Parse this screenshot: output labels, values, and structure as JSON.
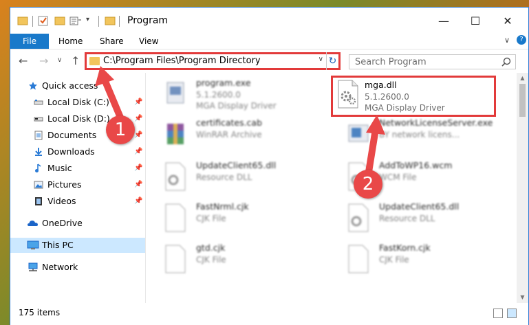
{
  "window": {
    "title": "Program",
    "minimize_glyph": "—",
    "maximize_glyph": "☐",
    "close_glyph": "✕"
  },
  "ribbon": {
    "tabs": [
      "File",
      "Home",
      "Share",
      "View"
    ],
    "expand_glyph": "∨",
    "help_glyph": "?"
  },
  "address": {
    "path": "C:\\Program Files\\Program Directory",
    "dropdown_glyph": "∨",
    "refresh_glyph": "↻",
    "back_glyph": "←",
    "forward_glyph": "→",
    "recent_glyph": "∨",
    "up_glyph": "↑"
  },
  "search": {
    "placeholder": "Search Program"
  },
  "nav": [
    {
      "label": "Quick access",
      "icon": "star-icon",
      "pinned": false
    },
    {
      "label": "Local Disk (C:)",
      "icon": "drive-icon",
      "pinned": true
    },
    {
      "label": "Local Disk (D:)",
      "icon": "drive-icon",
      "pinned": true
    },
    {
      "label": "Documents",
      "icon": "documents-icon",
      "pinned": true
    },
    {
      "label": "Downloads",
      "icon": "downloads-icon",
      "pinned": true
    },
    {
      "label": "Music",
      "icon": "music-icon",
      "pinned": true
    },
    {
      "label": "Pictures",
      "icon": "pictures-icon",
      "pinned": true
    },
    {
      "label": "Videos",
      "icon": "videos-icon",
      "pinned": true
    },
    {
      "label": "OneDrive",
      "icon": "onedrive-icon",
      "pinned": false
    },
    {
      "label": "This PC",
      "icon": "pc-icon",
      "pinned": false,
      "selected": true
    },
    {
      "label": "Network",
      "icon": "network-icon",
      "pinned": false
    }
  ],
  "files": [
    {
      "name": "program.exe",
      "line2": "5.1.2600.0",
      "line3": "MGA Display Driver",
      "icon": "exe-icon",
      "blurred": true
    },
    {
      "name": "mga.dll",
      "line2": "5.1.2600.0",
      "line3": "MGA Display Driver",
      "icon": "dll-gear-icon",
      "blurred": false,
      "highlighted": true
    },
    {
      "name": "certificates.cab",
      "line2": "WinRAR Archive",
      "line3": "",
      "icon": "winrar-icon",
      "blurred": true
    },
    {
      "name": "NetworkLicenseServer.exe",
      "line2": "BY network licens...",
      "line3": "",
      "icon": "exe-icon",
      "blurred": true
    },
    {
      "name": "UpdateClient65.dll",
      "line2": "Resource DLL",
      "line3": "",
      "icon": "dll-gear-icon",
      "blurred": true
    },
    {
      "name": "AddToWP16.wcm",
      "line2": "WCM File",
      "line3": "",
      "icon": "dll-gear-icon",
      "blurred": true
    },
    {
      "name": "FastNrml.cjk",
      "line2": "CJK File",
      "line3": "",
      "icon": "file-icon",
      "blurred": true
    },
    {
      "name": "UpdateClient65.dll",
      "line2": "Resource DLL",
      "line3": "",
      "icon": "dll-gear-icon",
      "blurred": true
    },
    {
      "name": "gtd.cjk",
      "line2": "CJK File",
      "line3": "",
      "icon": "file-icon",
      "blurred": true
    },
    {
      "name": "FastKorn.cjk",
      "line2": "CJK File",
      "line3": "",
      "icon": "file-icon",
      "blurred": true
    }
  ],
  "status": {
    "items_count": "175 items"
  },
  "callouts": [
    "1",
    "2"
  ],
  "colors": {
    "accent": "#1979ca",
    "highlight": "#e23a3a",
    "selected": "#cce8ff"
  }
}
